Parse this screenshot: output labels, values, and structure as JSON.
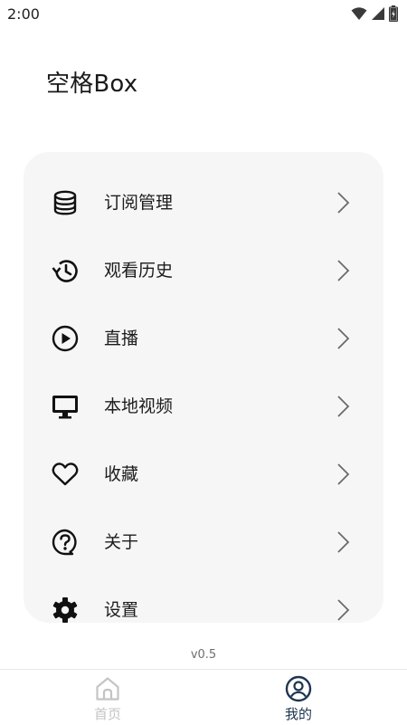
{
  "status_bar": {
    "time": "2:00",
    "icons": [
      "wifi-icon",
      "signal-icon",
      "battery-icon"
    ]
  },
  "app_title": "空格Box",
  "menu": {
    "items": [
      {
        "label": "订阅管理",
        "icon": "database-icon"
      },
      {
        "label": "观看历史",
        "icon": "history-icon"
      },
      {
        "label": "直播",
        "icon": "play-circle-icon"
      },
      {
        "label": "本地视频",
        "icon": "monitor-icon"
      },
      {
        "label": "收藏",
        "icon": "heart-icon"
      },
      {
        "label": "关于",
        "icon": "help-bubble-icon"
      },
      {
        "label": "设置",
        "icon": "gear-icon"
      }
    ],
    "chevron_icon": "chevron-right-icon"
  },
  "version": "v0.5",
  "bottom_nav": {
    "items": [
      {
        "label": "首页",
        "icon": "home-icon",
        "active": false
      },
      {
        "label": "我的",
        "icon": "user-circle-icon",
        "active": true
      }
    ]
  },
  "colors": {
    "card_background": "#f6f6f6",
    "active_nav": "#1e3550",
    "inactive_nav": "#c4c4c4",
    "text": "#1c1c1c"
  }
}
